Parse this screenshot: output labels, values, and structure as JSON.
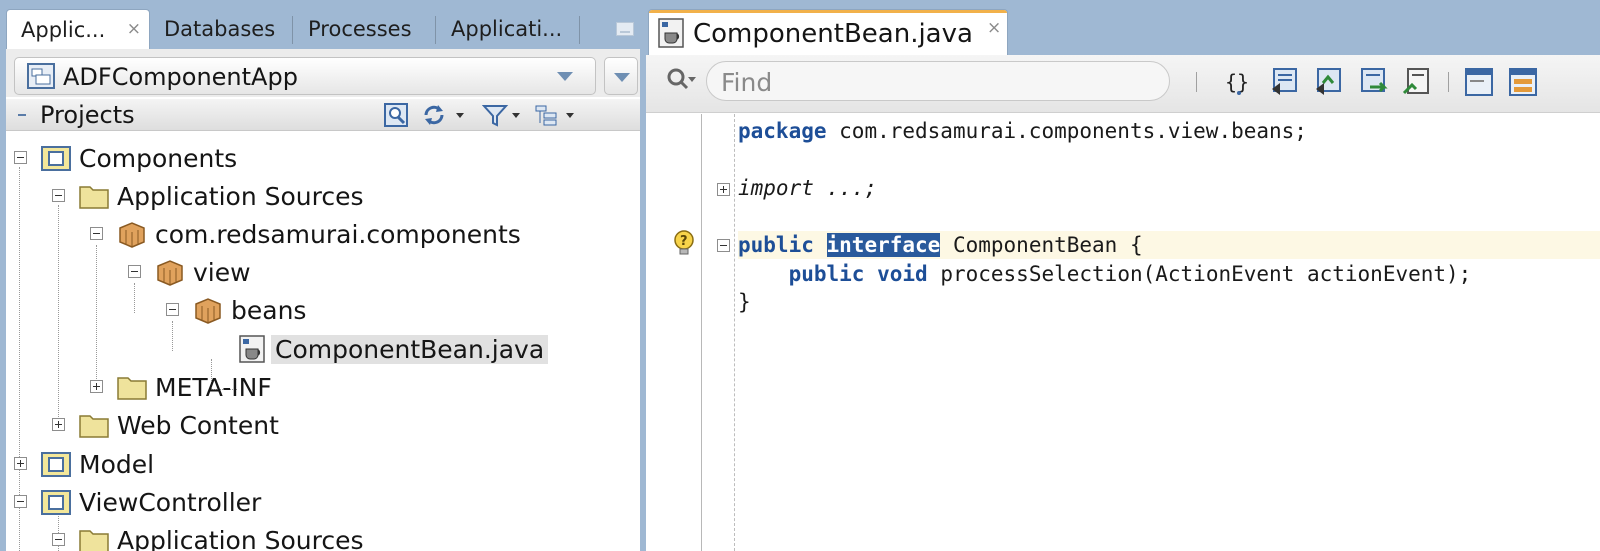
{
  "left_pane": {
    "tabs": [
      {
        "label": "Applic...",
        "active": true,
        "close": "×"
      },
      {
        "label": "Databases",
        "active": false
      },
      {
        "label": "Processes",
        "active": false
      },
      {
        "label": "Applicati...",
        "active": false
      }
    ],
    "app_selector": {
      "value": "ADFComponentApp"
    },
    "projects_header": {
      "title": "Projects"
    },
    "tree": [
      {
        "label": "Components",
        "icon": "project-folder-icon",
        "expanded": true
      },
      {
        "label": "Application Sources",
        "icon": "folder-icon",
        "expanded": true
      },
      {
        "label": "com.redsamurai.components",
        "icon": "package-icon",
        "expanded": true
      },
      {
        "label": "view",
        "icon": "package-icon",
        "expanded": true
      },
      {
        "label": "beans",
        "icon": "package-icon",
        "expanded": true
      },
      {
        "label": "ComponentBean.java",
        "icon": "java-file-icon",
        "selected": true
      },
      {
        "label": "META-INF",
        "icon": "folder-icon",
        "expanded": false
      },
      {
        "label": "Web Content",
        "icon": "folder-icon",
        "expanded": false
      },
      {
        "label": "Model",
        "icon": "project-folder-icon",
        "expanded": false
      },
      {
        "label": "ViewController",
        "icon": "project-folder-icon",
        "expanded": true
      },
      {
        "label": "Application Sources",
        "icon": "folder-icon",
        "expanded": true
      }
    ]
  },
  "editor": {
    "tab": {
      "label": "ComponentBean.java",
      "close": "×"
    },
    "find": {
      "placeholder": "Find"
    },
    "code": {
      "l1_kw": "package",
      "l1_rest": " com.redsamurai.components.view.beans;",
      "l2_kw": "import",
      "l2_rest": " ...;",
      "l3_kw": "public",
      "l3_sel": "interface",
      "l3_rest": " ComponentBean {",
      "l4_indent": "    ",
      "l4_kw1": "public",
      "l4_kw2": "void",
      "l4_rest": " processSelection(ActionEvent actionEvent);",
      "l5": "}"
    }
  },
  "colors": {
    "chrome_bg": "#9fb8d3",
    "keyword": "#1d4e97",
    "selection": "#2a5a9c",
    "tab_accent": "#f2b14a",
    "current_line": "#fdf8e4"
  }
}
